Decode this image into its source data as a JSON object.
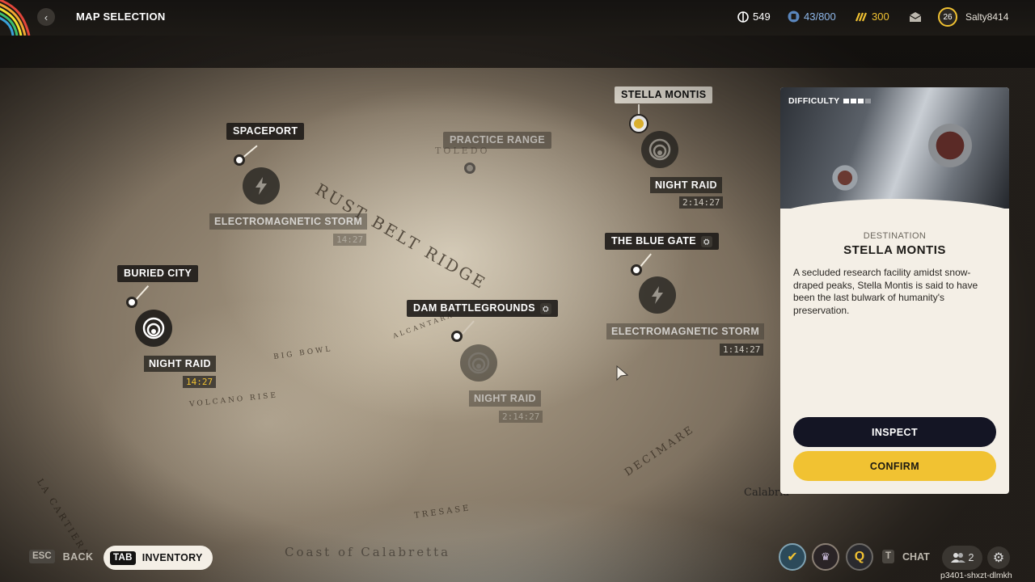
{
  "header": {
    "title": "MAP SELECTION",
    "currencies": [
      {
        "icon": "credits-icon",
        "value": "549",
        "color": "#ffffff"
      },
      {
        "icon": "stash-icon",
        "value": "43/800",
        "color": "#8fb8ea"
      },
      {
        "icon": "raider-tokens-icon",
        "value": "300",
        "color": "#f1c232"
      }
    ],
    "player_level": "26",
    "username": "Salty8414"
  },
  "map": {
    "regions": [
      "RUST BELT RIDGE",
      "BIG BOWL",
      "VOLCANO RISE",
      "LA CARTIERA",
      "DECIMARE",
      "ALCANTARA",
      "Coast of Calabretta",
      "TRESASE",
      "Calabria",
      "TOLEDO"
    ],
    "locations": [
      {
        "name": "STELLA MONTIS",
        "selected": true
      },
      {
        "name": "SPACEPORT"
      },
      {
        "name": "PRACTICE RANGE",
        "dim": true
      },
      {
        "name": "THE BLUE GATE",
        "badge": "lock-icon"
      },
      {
        "name": "BURIED CITY"
      },
      {
        "name": "DAM BATTLEGROUNDS",
        "badge": "lock-icon"
      }
    ],
    "events": [
      {
        "label": "NIGHT RAID",
        "timer": "2:14:27",
        "icon": "night-raid-icon"
      },
      {
        "label": "ELECTROMAGNETIC STORM",
        "timer": "14:27",
        "icon": "storm-icon"
      },
      {
        "label": "ELECTROMAGNETIC STORM",
        "timer": "1:14:27",
        "icon": "storm-icon"
      },
      {
        "label": "NIGHT RAID",
        "timer": "14:27",
        "icon": "night-raid-icon",
        "highlight": true
      },
      {
        "label": "NIGHT RAID",
        "timer": "2:14:27",
        "icon": "night-raid-icon",
        "dim": true
      }
    ]
  },
  "panel": {
    "difficulty_label": "DIFFICULTY",
    "difficulty_level": 0.75,
    "destination_caption": "DESTINATION",
    "destination_name": "STELLA MONTIS",
    "description": "A secluded research facility amidst snow-draped peaks, Stella Montis is said to have been the last bulwark of humanity's preservation.",
    "inspect_label": "INSPECT",
    "confirm_label": "CONFIRM"
  },
  "footer": {
    "esc_key": "ESC",
    "back_label": "BACK",
    "tab_key": "TAB",
    "inventory_label": "INVENTORY",
    "chat_key": "T",
    "chat_label": "CHAT",
    "party_count": "2",
    "session_id": "p3401-shxzt-dlmkh"
  }
}
